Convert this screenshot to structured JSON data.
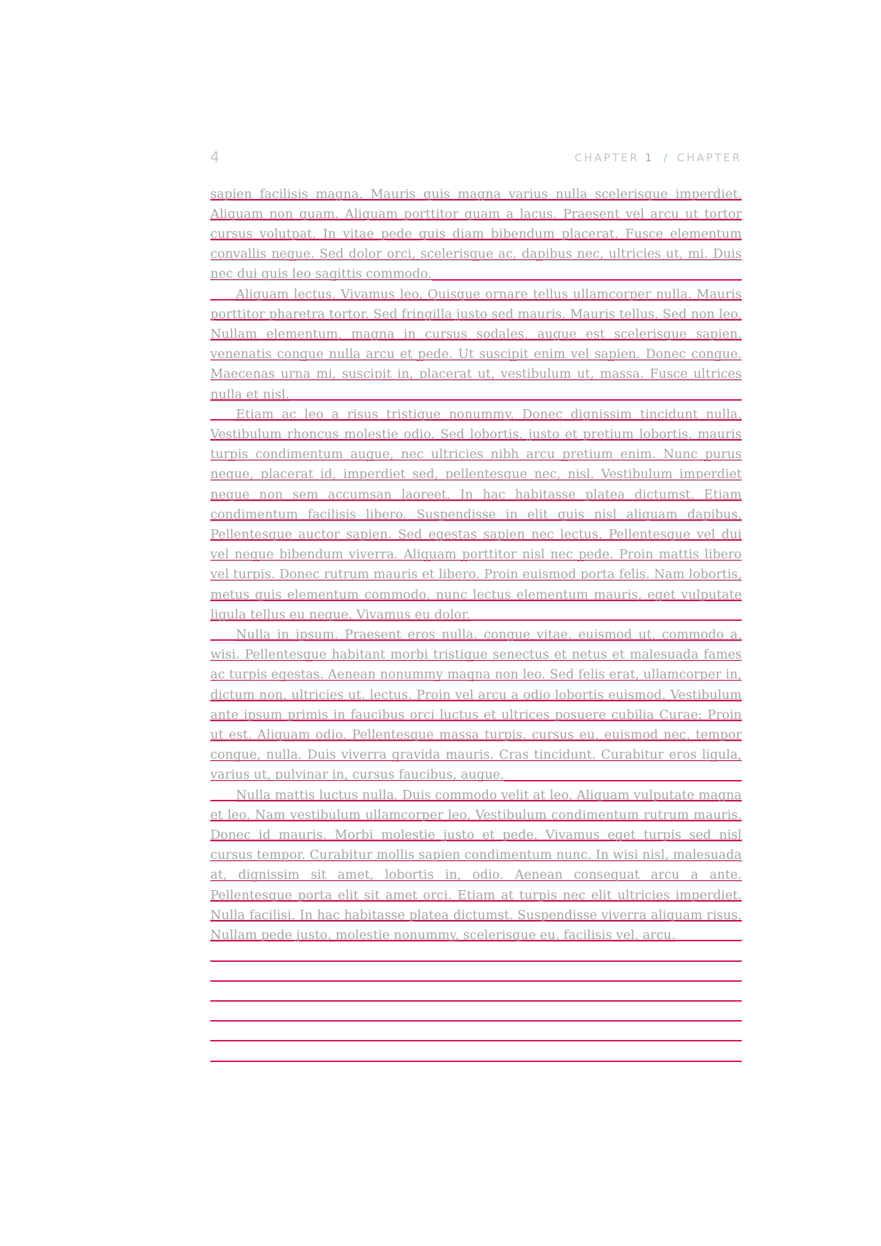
{
  "header": {
    "page_number": "4",
    "chapter_label": "CHAPTER",
    "chapter_number": "1",
    "separator": "/",
    "chapter_title": "CHAPTER"
  },
  "baseline_rule_color": "#d3124a",
  "text_color": "#a4a4a4",
  "paragraphs": [
    "sapien facilisis magna. Mauris quis magna varius nulla scelerisque imperdiet. Aliquam non quam. Aliquam porttitor quam a lacus. Praesent vel arcu ut tortor cursus volutpat. In vitae pede quis diam bibendum placerat. Fusce elementum convallis neque. Sed dolor orci, scelerisque ac, dapibus nec, ultricies ut, mi. Duis nec dui quis leo sagittis commodo.",
    "Aliquam lectus. Vivamus leo. Quisque ornare tellus ullamcorper nulla. Mauris porttitor pharetra tortor. Sed fringilla justo sed mauris. Mauris tellus. Sed non leo. Nullam elementum, magna in cursus sodales, augue est scelerisque sapien, venenatis congue nulla arcu et pede. Ut suscipit enim vel sapien. Donec congue. Maecenas urna mi, suscipit in, placerat ut, vestibulum ut, massa. Fusce ultrices nulla et nisl.",
    "Etiam ac leo a risus tristique nonummy. Donec dignissim tincidunt nulla. Vestibulum rhoncus molestie odio. Sed lobortis, justo et pretium lobortis, mauris turpis condimentum augue, nec ultricies nibh arcu pretium enim. Nunc purus neque, placerat id, imperdiet sed, pellentesque nec, nisl. Vestibulum imperdiet neque non sem accumsan laoreet. In hac habitasse platea dictumst. Etiam condimentum facilisis libero. Suspendisse in elit quis nisl aliquam dapibus. Pellentesque auctor sapien. Sed egestas sapien nec lectus. Pellentesque vel dui vel neque bibendum viverra. Aliquam porttitor nisl nec pede. Proin mattis libero vel turpis. Donec rutrum mauris et libero. Proin euismod porta felis. Nam lobortis, metus quis elementum commodo, nunc lectus elementum mauris, eget vulputate ligula tellus eu neque. Vivamus eu dolor.",
    "Nulla in ipsum. Praesent eros nulla, congue vitae, euismod ut, commodo a, wisi. Pellentesque habitant morbi tristique senectus et netus et malesuada fames ac turpis egestas. Aenean nonummy magna non leo. Sed felis erat, ullamcorper in, dictum non, ultricies ut, lectus. Proin vel arcu a odio lobortis euismod. Vestibulum ante ipsum primis in faucibus orci luctus et ultrices posuere cubilia Curae; Proin ut est. Aliquam odio. Pellentesque massa turpis, cursus eu, euismod nec, tempor congue, nulla. Duis viverra gravida mauris. Cras tincidunt. Curabitur eros ligula, varius ut, pulvinar in, cursus faucibus, augue.",
    "Nulla mattis luctus nulla. Duis commodo velit at leo. Aliquam vulputate magna et leo. Nam vestibulum ullamcorper leo. Vestibulum condimentum rutrum mauris. Donec id mauris. Morbi molestie justo et pede. Vivamus eget turpis sed nisl cursus tempor. Curabitur mollis sapien condimentum nunc. In wisi nisl, malesuada at, dignissim sit amet, lobortis in, odio. Aenean consequat arcu a ante. Pellentesque porta elit sit amet orci. Etiam at turpis nec elit ultricies imperdiet. Nulla facilisi. In hac habitasse platea dictumst. Suspendisse viverra aliquam risus. Nullam pede justo, molestie nonummy, scelerisque eu, facilisis vel, arcu."
  ]
}
